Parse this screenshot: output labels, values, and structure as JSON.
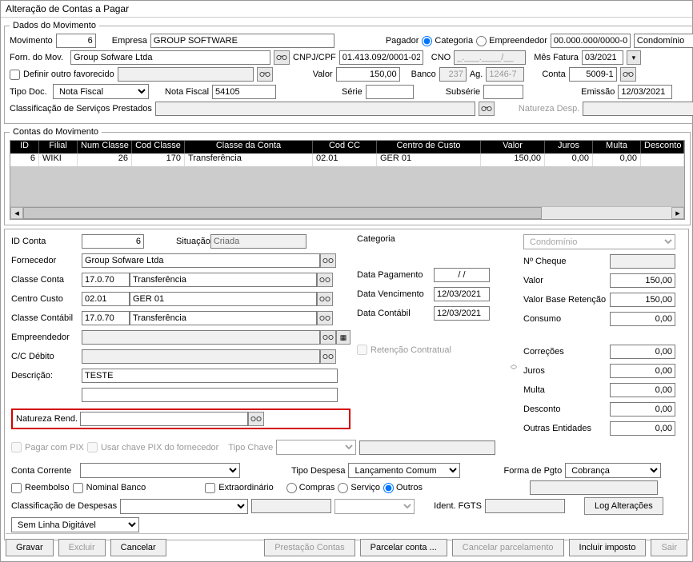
{
  "window_title": "Alteração de Contas a Pagar",
  "dados": {
    "legend": "Dados do Movimento",
    "movimento_label": "Movimento",
    "movimento": "6",
    "empresa_label": "Empresa",
    "empresa": "GROUP SOFTWARE",
    "pagador_label": "Pagador",
    "categoria_opt": "Categoria",
    "empreendedor_opt": "Empreendedor",
    "cnpj_payer": "00.000.000/0000-00",
    "condominio": "Condomínio",
    "forn_mov_label": "Forn. do Mov.",
    "forn_mov": "Group Sofware Ltda",
    "cnpj_cpf_label": "CNPJ/CPF",
    "cnpj_cpf": "01.413.092/0001-02",
    "cno_label": "CNO",
    "cno": "_.___.____/__",
    "mes_fatura_label": "Mês Fatura",
    "mes_fatura": "03/2021",
    "definir_outro_label": "Definir outro favorecido",
    "definir_outro": "",
    "valor_label": "Valor",
    "valor": "150,00",
    "banco_label": "Banco",
    "banco": "237",
    "ag_label": "Ag.",
    "ag": "1246-7",
    "conta_label": "Conta",
    "conta": "5009-1",
    "tipo_doc_label": "Tipo Doc.",
    "tipo_doc": "Nota Fiscal",
    "nota_fiscal_label": "Nota Fiscal",
    "nota_fiscal": "54105",
    "serie_label": "Série",
    "serie": "",
    "subserie_label": "Subsérie",
    "subserie": "",
    "emissao_label": "Emissão",
    "emissao": "12/03/2021",
    "classif_serv_label": "Classificação de Serviços Prestados",
    "classif_serv": "",
    "nat_desp_label": "Natureza Desp.",
    "nat_desp": ""
  },
  "contas_mov": {
    "legend": "Contas do Movimento",
    "headers": [
      "ID",
      "Filial",
      "Num Classe",
      "Cod Classe",
      "Classe da Conta",
      "Cod CC",
      "Centro de Custo",
      "Valor",
      "Juros",
      "Multa",
      "Desconto"
    ],
    "row": [
      "6",
      "WIKI",
      "26",
      "170",
      "Transferência",
      "02.01",
      "GER 01",
      "150,00",
      "0,00",
      "0,00",
      ""
    ]
  },
  "detail": {
    "id_conta_label": "ID Conta",
    "id_conta": "6",
    "situacao_label": "Situação",
    "situacao": "Criada",
    "categoria_label": "Categoria",
    "categoria": "Condomínio",
    "cheque_label": "Nº Cheque",
    "cheque": "",
    "fornecedor_label": "Fornecedor",
    "fornecedor": "Group Sofware Ltda",
    "classe_conta_label": "Classe Conta",
    "classe_conta_cod": "17.0.70",
    "classe_conta_nome": "Transferência",
    "data_pag_label": "Data Pagamento",
    "data_pag": "/ /",
    "valor_label": "Valor",
    "valor": "150,00",
    "centro_custo_label": "Centro Custo",
    "centro_custo_cod": "02.01",
    "centro_custo_nome": "GER 01",
    "data_venc_label": "Data Vencimento",
    "data_venc": "12/03/2021",
    "valor_base_label": "Valor Base Retenção",
    "valor_base": "150,00",
    "classe_contabil_label": "Classe Contábil",
    "classe_contabil_cod": "17.0.70",
    "classe_contabil_nome": "Transferência",
    "data_contabil_label": "Data Contábil",
    "data_contabil": "12/03/2021",
    "consumo_label": "Consumo",
    "consumo": "0,00",
    "empreendedor_label": "Empreendedor",
    "empreendedor": "",
    "cc_debito_label": "C/C Débito",
    "cc_debito": "",
    "ret_contratual_label": "Retenção Contratual",
    "correcoes_label": "Correções",
    "correcoes": "0,00",
    "descricao_label": "Descrição:",
    "descricao": "TESTE",
    "juros_label": "Juros",
    "juros": "0,00",
    "multa_label": "Multa",
    "multa": "0,00",
    "nat_rend_label": "Natureza Rend.",
    "nat_rend": "",
    "desconto_label": "Desconto",
    "desconto": "0,00",
    "outras_ent_label": "Outras Entidades",
    "outras_ent": "0,00",
    "pagar_pix_label": "Pagar com PIX",
    "usar_chave_label": "Usar chave PIX do fornecedor",
    "tipo_chave_label": "Tipo Chave",
    "conta_corrente_label": "Conta Corrente",
    "tipo_despesa_label": "Tipo Despesa",
    "tipo_despesa": "Lançamento Comum",
    "forma_pgto_label": "Forma de Pgto",
    "forma_pgto": "Cobrança",
    "reembolso_label": "Reembolso",
    "nominal_banco_label": "Nominal Banco",
    "extraordinario_label": "Extraordinário",
    "compras_label": "Compras",
    "servico_label": "Serviço",
    "outros_label": "Outros",
    "classif_desp_label": "Classificação de Despesas",
    "ident_fgts_label": "Ident. FGTS",
    "ident_fgts": "",
    "log_alt_label": "Log Alterações",
    "sem_linha_label": "Sem Linha Digitável"
  },
  "buttons": {
    "gravar": "Gravar",
    "excluir": "Excluir",
    "cancelar": "Cancelar",
    "prestacao": "Prestação Contas",
    "parcelar": "Parcelar conta ...",
    "cancelar_parc": "Cancelar parcelamento",
    "incluir_imp": "Incluir imposto",
    "sair": "Sair"
  }
}
